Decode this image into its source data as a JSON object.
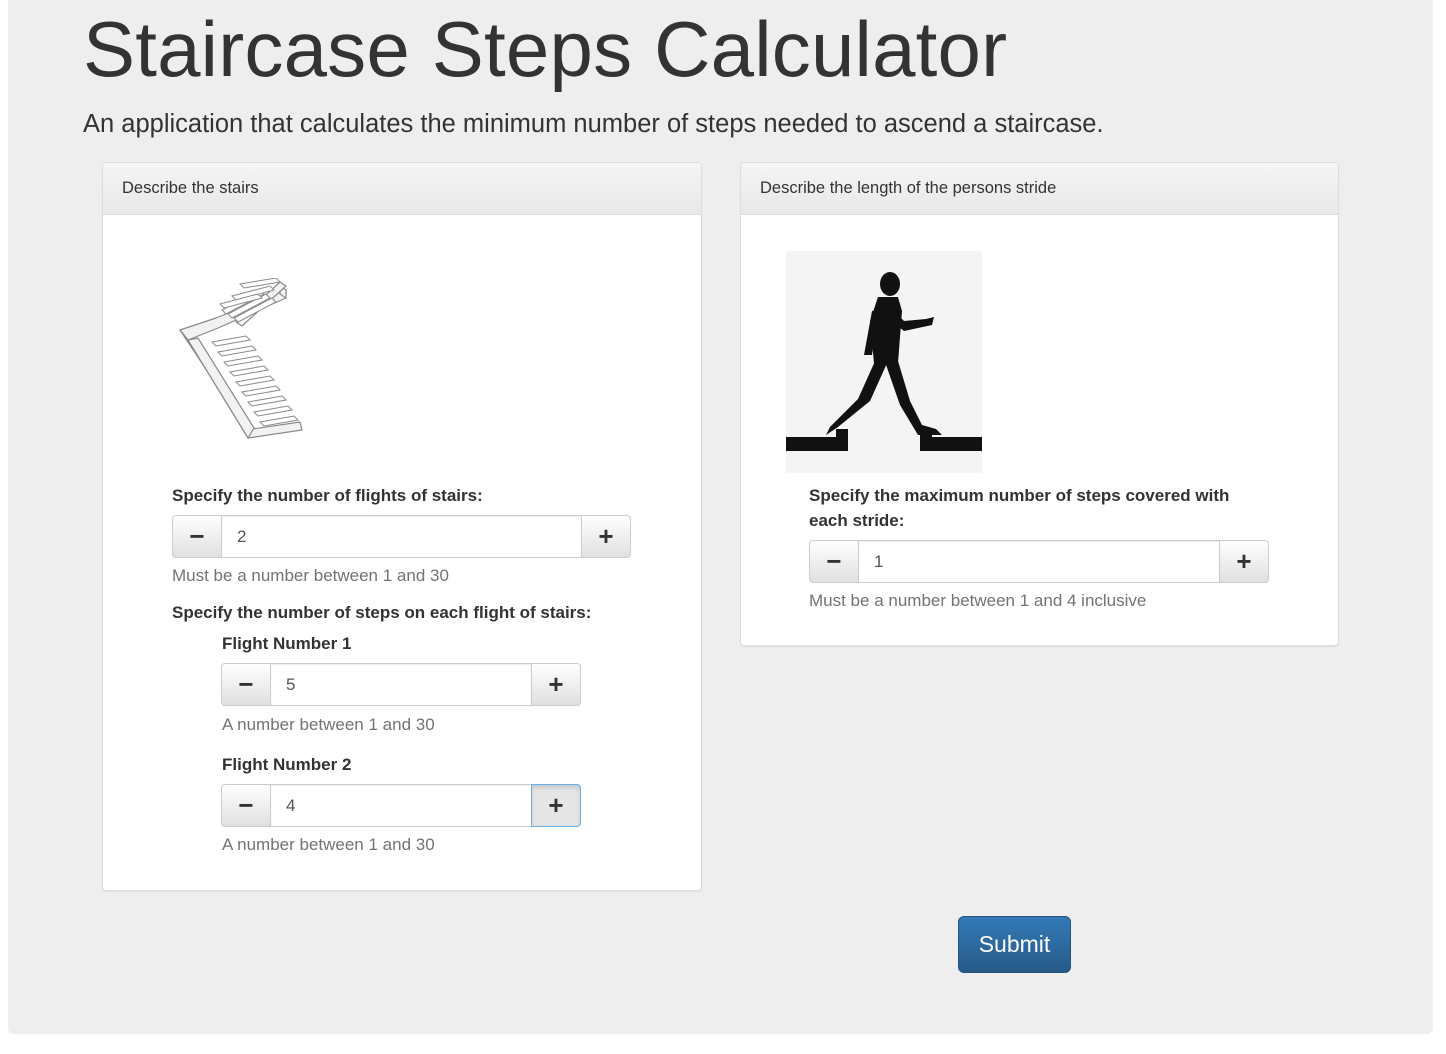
{
  "header": {
    "title": "Staircase Steps Calculator",
    "subtitle": "An application that calculates the minimum number of steps needed to ascend a staircase."
  },
  "stairs_panel": {
    "heading": "Describe the stairs",
    "image_icon": "staircase-illustration",
    "flights": {
      "label": "Specify the number of flights of stairs:",
      "value": "2",
      "help": "Must be a number between 1 and 30"
    },
    "steps_label": "Specify the number of steps on each flight of stairs:",
    "flight_items": [
      {
        "label": "Flight Number 1",
        "value": "5",
        "help": "A number between 1 and 30"
      },
      {
        "label": "Flight Number 2",
        "value": "4",
        "help": "A number between 1 and 30"
      }
    ]
  },
  "stride_panel": {
    "heading": "Describe the length of the persons stride",
    "image_icon": "walking-person-silhouette",
    "stride": {
      "label_line1": "Specify the maximum number of steps covered with",
      "label_line2": "each stride:",
      "value": "1",
      "help": "Must be a number between 1 and 4 inclusive"
    }
  },
  "controls": {
    "minus_symbol": "−",
    "plus_symbol": "+",
    "submit_label": "Submit"
  },
  "colors": {
    "background": "#eeeeee",
    "primary": "#337ab7",
    "focus_border": "#66afe9"
  }
}
